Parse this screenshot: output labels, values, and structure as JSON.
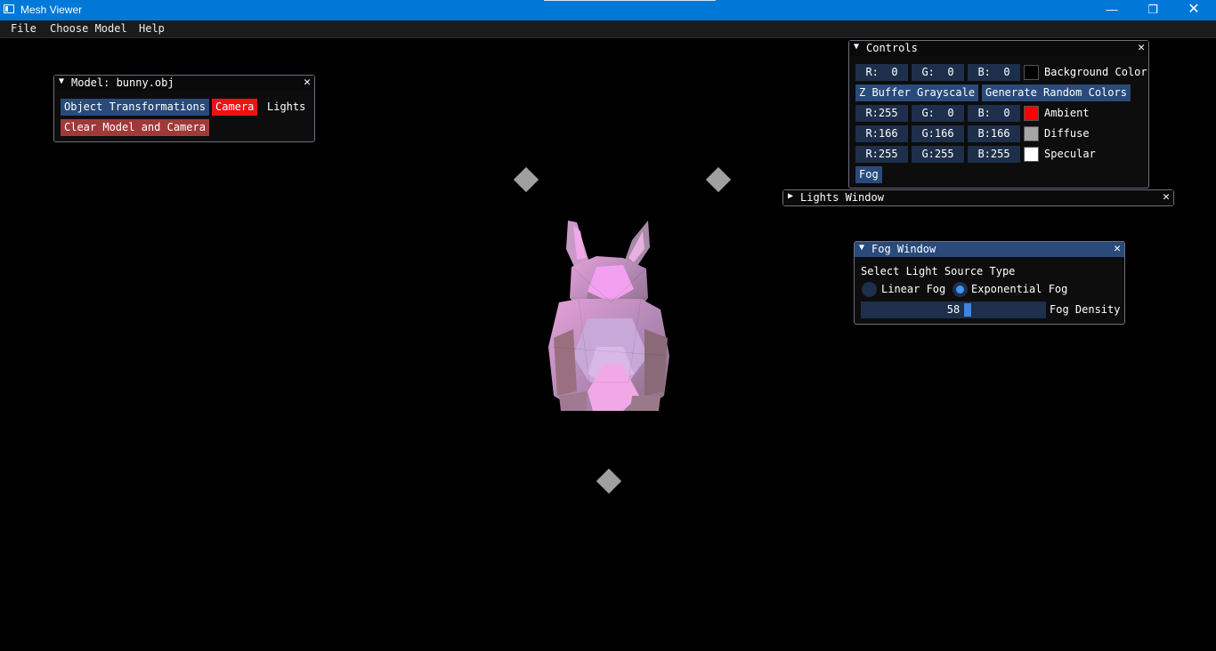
{
  "window": {
    "title": "Mesh Viewer",
    "minimize_icon": "minimize-icon",
    "maximize_icon": "restore-icon",
    "close_icon": "close-icon"
  },
  "menu": {
    "items": [
      "File",
      "Choose Model",
      "Help"
    ]
  },
  "model_panel": {
    "title": "Model: bunny.obj",
    "object_transformations": "Object Transformations",
    "camera": "Camera",
    "lights": "Lights",
    "clear": "Clear Model and Camera"
  },
  "controls": {
    "title": "Controls",
    "rows": [
      {
        "r": "R:  0",
        "g": "G:  0",
        "b": "B:  0",
        "color": "#000000",
        "label": "Background Color"
      },
      {
        "r": "R:255",
        "g": "G:  0",
        "b": "B:  0",
        "color": "#ff0000",
        "label": "Ambient"
      },
      {
        "r": "R:166",
        "g": "G:166",
        "b": "B:166",
        "color": "#a6a6a6",
        "label": "Diffuse"
      },
      {
        "r": "R:255",
        "g": "G:255",
        "b": "B:255",
        "color": "#ffffff",
        "label": "Specular"
      }
    ],
    "zbuffer": "Z Buffer Grayscale",
    "random_colors": "Generate Random Colors",
    "fog": "Fog"
  },
  "lights_window": {
    "title": "Lights Window"
  },
  "fog_window": {
    "title": "Fog Window",
    "subtitle": "Select Light Source Type",
    "linear": "Linear Fog",
    "exponential": "Exponential Fog",
    "density_value": "58",
    "density_label": "Fog Density",
    "selected": "exponential"
  },
  "colors": {
    "accent": "#294a7a",
    "title_bar": "#0078d7",
    "camera_active": "#ee1111"
  }
}
